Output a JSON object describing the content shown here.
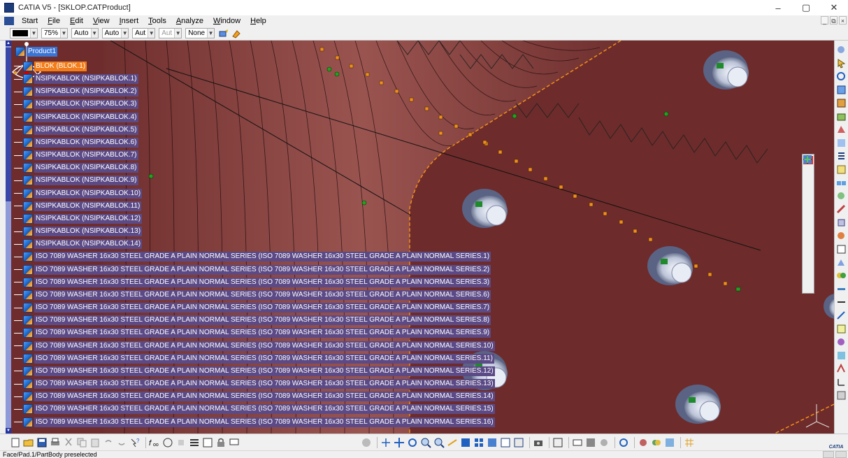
{
  "window": {
    "title": "CATIA V5 - [SKLOP.CATProduct]",
    "controls": {
      "minimize": "–",
      "maximize": "▢",
      "close": "✕"
    }
  },
  "menu": {
    "start": "Start",
    "items": [
      "File",
      "Edit",
      "View",
      "Insert",
      "Tools",
      "Analyze",
      "Window",
      "Help"
    ],
    "mdi_controls": [
      "_",
      "⧉",
      "×"
    ]
  },
  "properties_toolbar": {
    "zoom": "75%",
    "linetype": "Auto",
    "thickness": "Auto",
    "layer_a": "Aut",
    "layer_b": "Aut",
    "layer_none": "None"
  },
  "tree": {
    "root": "Product1",
    "selected": "BLOK (BLOK.1)",
    "nodes": [
      "NSIPKABLOK (NSIPKABLOK.1)",
      "NSIPKABLOK (NSIPKABLOK.2)",
      "NSIPKABLOK (NSIPKABLOK.3)",
      "NSIPKABLOK (NSIPKABLOK.4)",
      "NSIPKABLOK (NSIPKABLOK.5)",
      "NSIPKABLOK (NSIPKABLOK.6)",
      "NSIPKABLOK (NSIPKABLOK.7)",
      "NSIPKABLOK (NSIPKABLOK.8)",
      "NSIPKABLOK (NSIPKABLOK.9)",
      "NSIPKABLOK (NSIPKABLOK.10)",
      "NSIPKABLOK (NSIPKABLOK.11)",
      "NSIPKABLOK (NSIPKABLOK.12)",
      "NSIPKABLOK (NSIPKABLOK.13)",
      "NSIPKABLOK (NSIPKABLOK.14)",
      "ISO 7089 WASHER 16x30 STEEL GRADE A PLAIN NORMAL SERIES (ISO 7089 WASHER 16x30 STEEL GRADE A PLAIN NORMAL SERIES.1)",
      "ISO 7089 WASHER 16x30 STEEL GRADE A PLAIN NORMAL SERIES (ISO 7089 WASHER 16x30 STEEL GRADE A PLAIN NORMAL SERIES.2)",
      "ISO 7089 WASHER 16x30 STEEL GRADE A PLAIN NORMAL SERIES (ISO 7089 WASHER 16x30 STEEL GRADE A PLAIN NORMAL SERIES.3)",
      "ISO 7089 WASHER 16x30 STEEL GRADE A PLAIN NORMAL SERIES (ISO 7089 WASHER 16x30 STEEL GRADE A PLAIN NORMAL SERIES.6)",
      "ISO 7089 WASHER 16x30 STEEL GRADE A PLAIN NORMAL SERIES (ISO 7089 WASHER 16x30 STEEL GRADE A PLAIN NORMAL SERIES.7)",
      "ISO 7089 WASHER 16x30 STEEL GRADE A PLAIN NORMAL SERIES (ISO 7089 WASHER 16x30 STEEL GRADE A PLAIN NORMAL SERIES.8)",
      "ISO 7089 WASHER 16x30 STEEL GRADE A PLAIN NORMAL SERIES (ISO 7089 WASHER 16x30 STEEL GRADE A PLAIN NORMAL SERIES.9)",
      "ISO 7089 WASHER 16x30 STEEL GRADE A PLAIN NORMAL SERIES (ISO 7089 WASHER 16x30 STEEL GRADE A PLAIN NORMAL SERIES.10)",
      "ISO 7089 WASHER 16x30 STEEL GRADE A PLAIN NORMAL SERIES (ISO 7089 WASHER 16x30 STEEL GRADE A PLAIN NORMAL SERIES.11)",
      "ISO 7089 WASHER 16x30 STEEL GRADE A PLAIN NORMAL SERIES (ISO 7089 WASHER 16x30 STEEL GRADE A PLAIN NORMAL SERIES.12)",
      "ISO 7089 WASHER 16x30 STEEL GRADE A PLAIN NORMAL SERIES (ISO 7089 WASHER 16x30 STEEL GRADE A PLAIN NORMAL SERIES.13)",
      "ISO 7089 WASHER 16x30 STEEL GRADE A PLAIN NORMAL SERIES (ISO 7089 WASHER 16x30 STEEL GRADE A PLAIN NORMAL SERIES.14)",
      "ISO 7089 WASHER 16x30 STEEL GRADE A PLAIN NORMAL SERIES (ISO 7089 WASHER 16x30 STEEL GRADE A PLAIN NORMAL SERIES.15)",
      "ISO 7089 WASHER 16x30 STEEL GRADE A PLAIN NORMAL SERIES (ISO 7089 WASHER 16x30 STEEL GRADE A PLAIN NORMAL SERIES.16)"
    ]
  },
  "colors": {
    "viewport_bg": "#6f2c2c",
    "surface": "#7a3a38",
    "surface_light": "#8d4845",
    "tree_label_bg": "#5b4a86",
    "selected_bg": "#f27d1a",
    "root_bg": "#3a74d4"
  },
  "status": {
    "text": "Face/Pad.1/PartBody preselected"
  },
  "brand": {
    "logo_text": "CATIA"
  }
}
